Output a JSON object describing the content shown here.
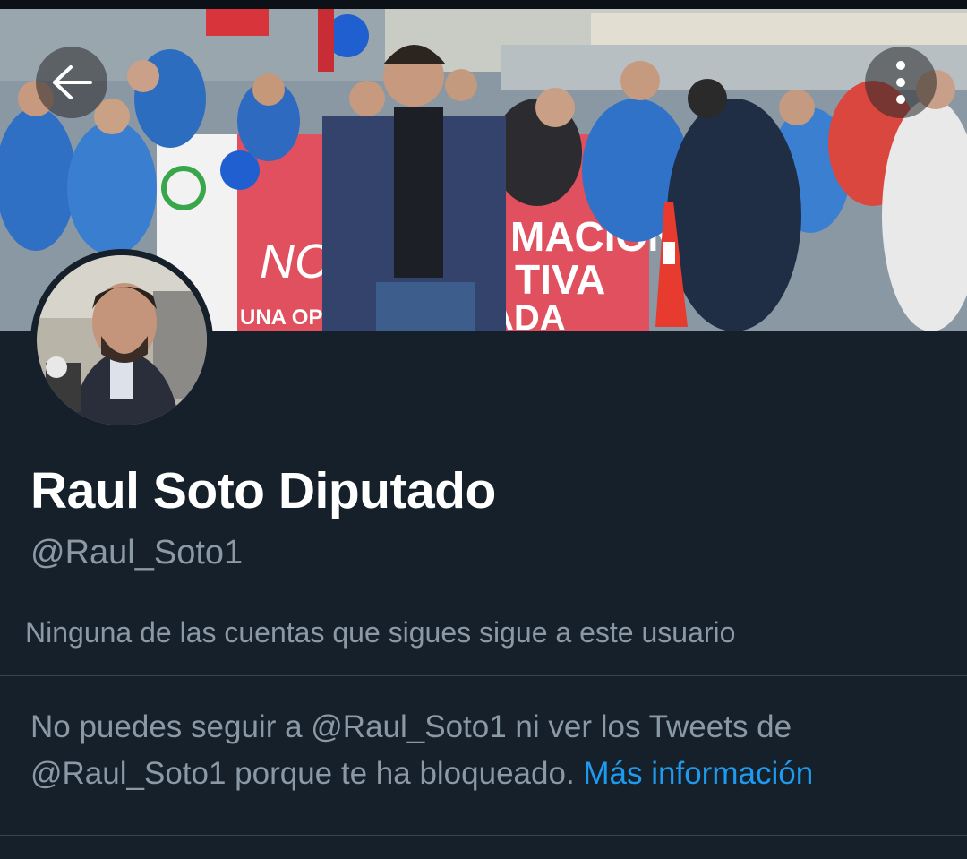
{
  "profile": {
    "display_name": "Raul Soto Diputado",
    "handle": "@Raul_Soto1",
    "followers_you_know": "Ninguna de las cuentas que sigues sigue a este usuario"
  },
  "blocked_notice": {
    "text": "No puedes seguir a @Raul_Soto1 ni ver los Tweets de @Raul_Soto1 porque te ha bloqueado.",
    "link_label": "Más información"
  },
  "banner": {
    "sign_text_1": "MACIÓN",
    "sign_text_2": "TIVA",
    "sign_text_3": "ADA",
    "sign_text_4": "UNA OPORTUNIDA",
    "sign_text_5": "NCR"
  },
  "icons": {
    "back": "arrow-left-icon",
    "more": "more-vertical-icon"
  },
  "colors": {
    "background": "#15202b",
    "text_primary": "#ffffff",
    "text_secondary": "#8b98a5",
    "link": "#1d9bf0",
    "divider": "#38444d"
  }
}
